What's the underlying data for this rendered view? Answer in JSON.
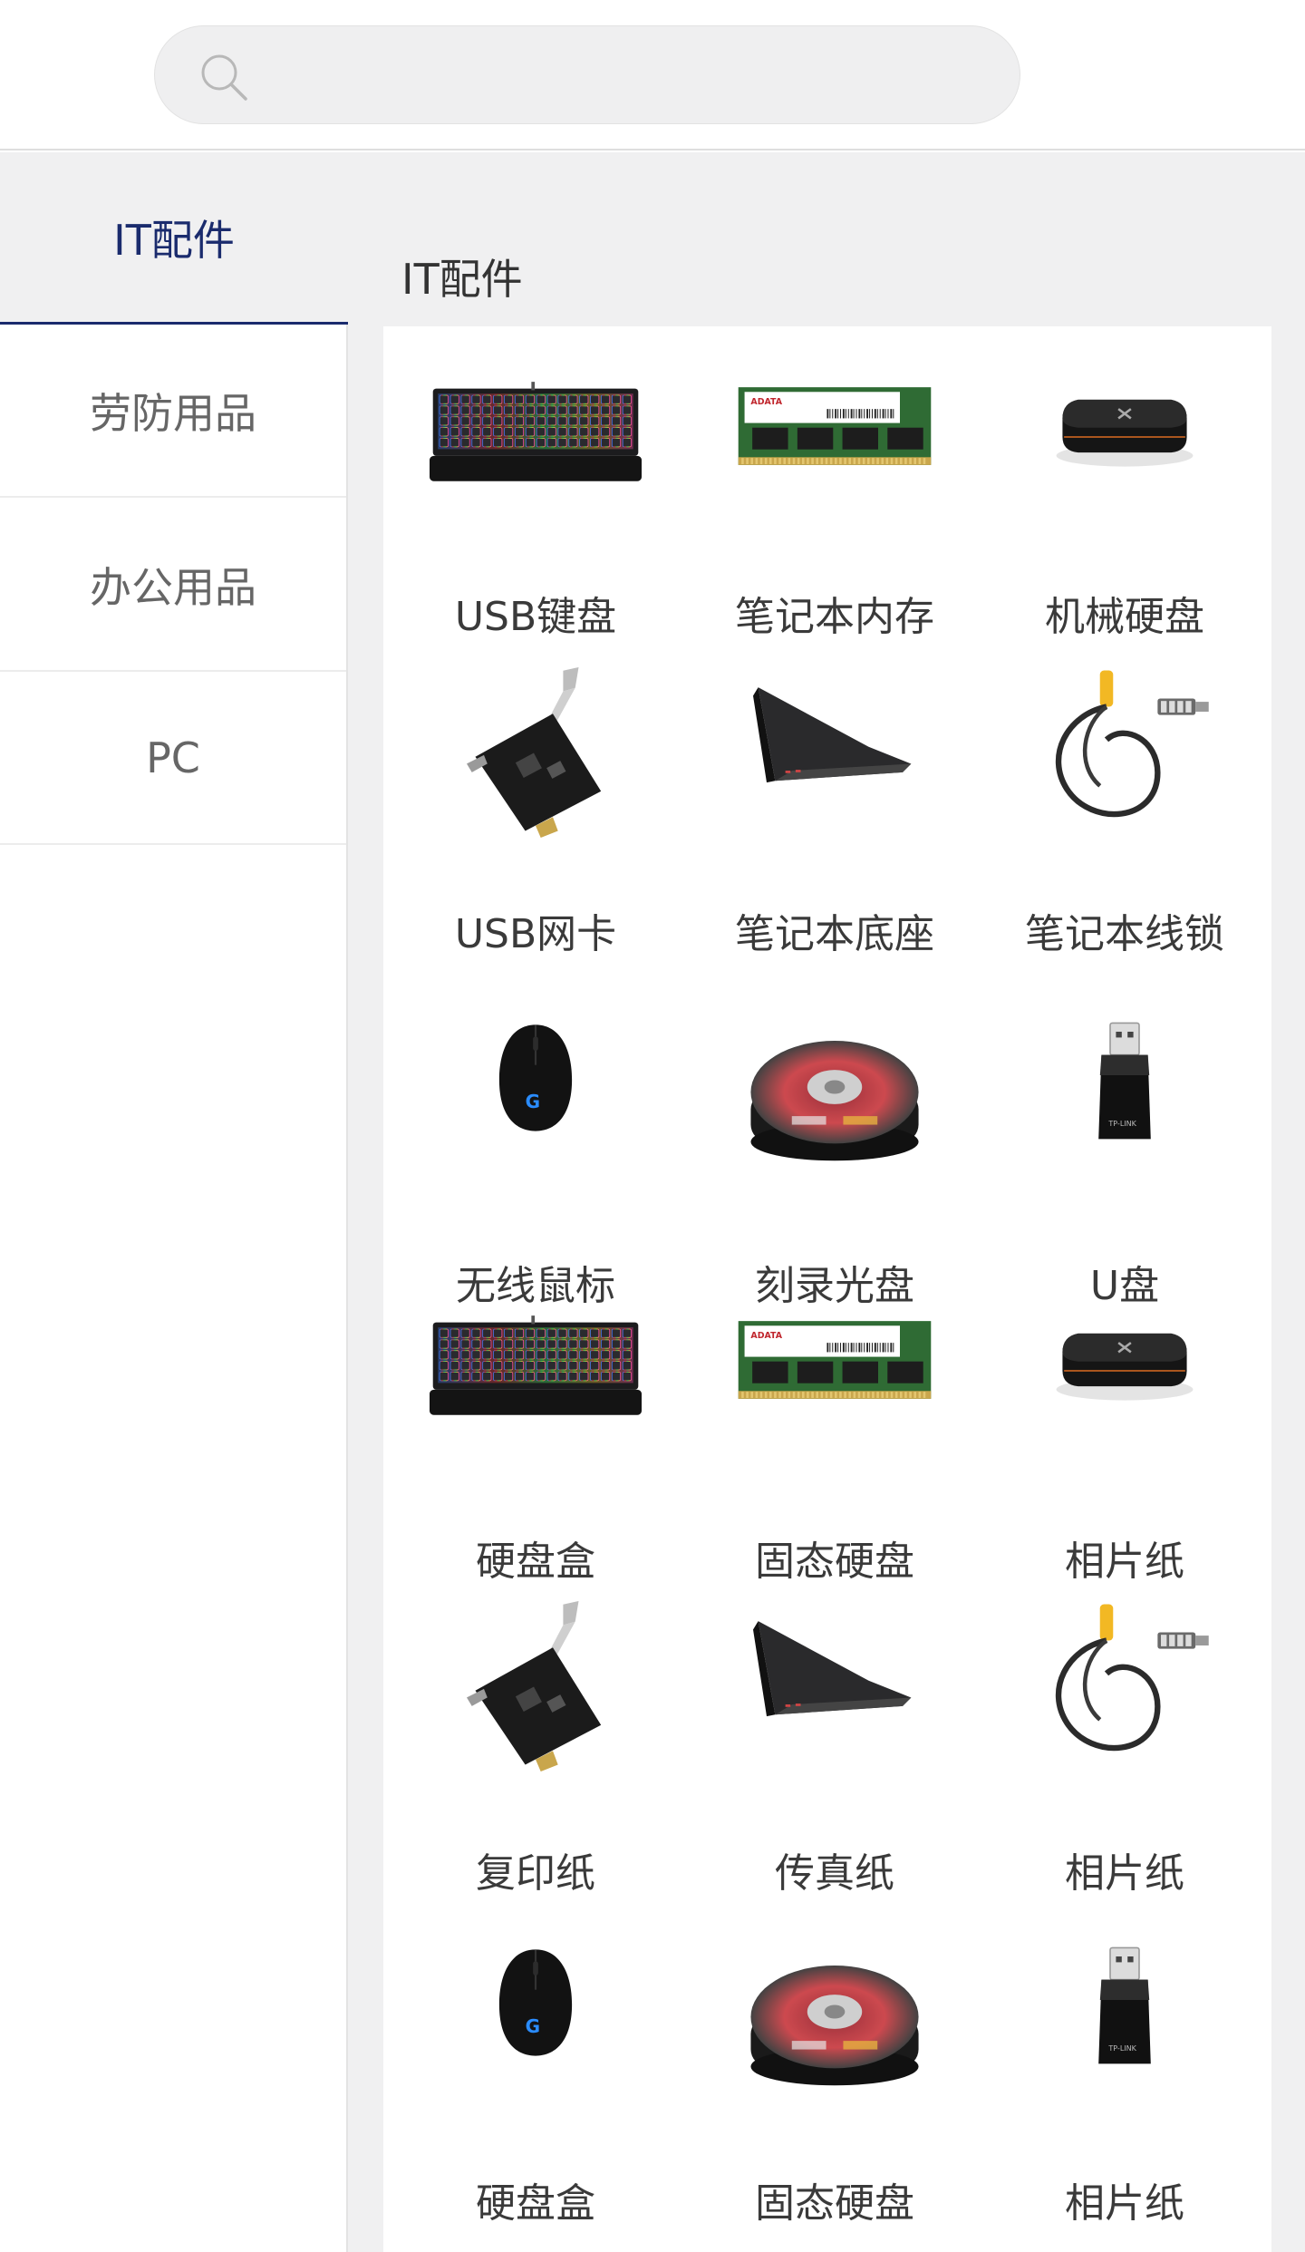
{
  "search": {
    "placeholder": ""
  },
  "sidebar": {
    "items": [
      {
        "label": "IT配件",
        "active": true
      },
      {
        "label": "劳防用品",
        "active": false
      },
      {
        "label": "办公用品",
        "active": false
      },
      {
        "label": "PC",
        "active": false
      }
    ]
  },
  "content": {
    "title": "IT配件",
    "products": [
      {
        "label": "USB键盘",
        "icon": "keyboard"
      },
      {
        "label": "笔记本内存",
        "icon": "memory"
      },
      {
        "label": "机械硬盘",
        "icon": "minipc"
      },
      {
        "label": "USB网卡",
        "icon": "netcard"
      },
      {
        "label": "笔记本底座",
        "icon": "laptopstand"
      },
      {
        "label": "笔记本线锁",
        "icon": "cablelock"
      },
      {
        "label": "无线鼠标",
        "icon": "mouse"
      },
      {
        "label": "刻录光盘",
        "icon": "disc"
      },
      {
        "label": "U盘",
        "icon": "usbdrive"
      },
      {
        "label": "硬盘盒",
        "icon": "keyboard"
      },
      {
        "label": "固态硬盘",
        "icon": "memory"
      },
      {
        "label": "相片纸",
        "icon": "minipc"
      },
      {
        "label": "复印纸",
        "icon": "netcard"
      },
      {
        "label": "传真纸",
        "icon": "laptopstand"
      },
      {
        "label": "相片纸",
        "icon": "cablelock"
      },
      {
        "label": "硬盘盒",
        "icon": "mouse"
      },
      {
        "label": "固态硬盘",
        "icon": "disc"
      },
      {
        "label": "相片纸",
        "icon": "usbdrive"
      }
    ]
  },
  "colors": {
    "accent": "#1a2b6d",
    "background": "#f0f0f1",
    "panel": "#ffffff"
  }
}
